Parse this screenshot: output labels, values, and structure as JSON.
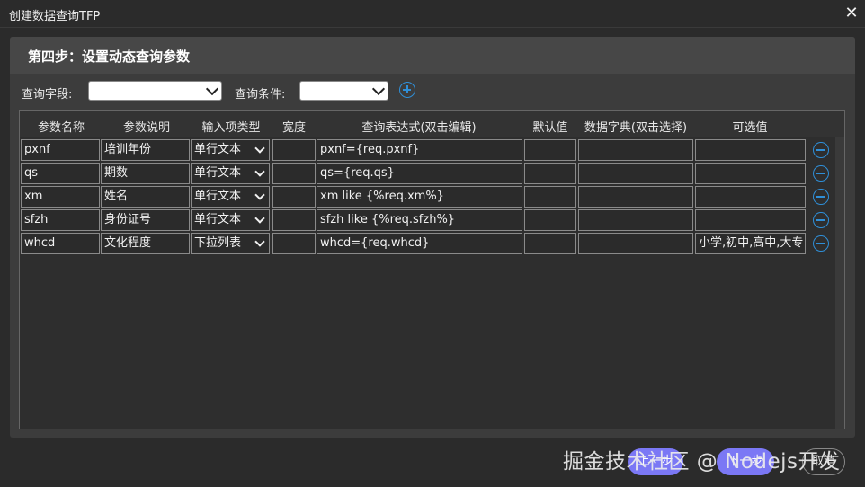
{
  "window": {
    "title": "创建数据查询TFP",
    "close_glyph": "✕"
  },
  "step_title": "第四步：设置动态查询参数",
  "filters": {
    "field_label": "查询字段:",
    "condition_label": "查询条件:"
  },
  "columns": [
    "参数名称",
    "参数说明",
    "输入项类型",
    "宽度",
    "查询表达式(双击编辑)",
    "默认值",
    "数据字典(双击选择)",
    "可选值"
  ],
  "rows": [
    {
      "name": "pxnf",
      "desc": "培训年份",
      "type": "单行文本",
      "width": "",
      "expr": "pxnf={req.pxnf}",
      "default": "",
      "dict": "",
      "options": ""
    },
    {
      "name": "qs",
      "desc": "期数",
      "type": "单行文本",
      "width": "",
      "expr": "qs={req.qs}",
      "default": "",
      "dict": "",
      "options": ""
    },
    {
      "name": "xm",
      "desc": "姓名",
      "type": "单行文本",
      "width": "",
      "expr": "xm like {%req.xm%}",
      "default": "",
      "dict": "",
      "options": ""
    },
    {
      "name": "sfzh",
      "desc": "身份证号",
      "type": "单行文本",
      "width": "",
      "expr": "sfzh like {%req.sfzh%}",
      "default": "",
      "dict": "",
      "options": ""
    },
    {
      "name": "whcd",
      "desc": "文化程度",
      "type": "下拉列表",
      "width": "",
      "expr": "whcd={req.whcd}",
      "default": "",
      "dict": "",
      "options": "小学,初中,高中,大专"
    }
  ],
  "footer": {
    "prev_label": "上一步",
    "next_label": "下一步",
    "cancel_label": "取消"
  },
  "watermark": "掘金技术社区 @ Nodejs开发",
  "colors": {
    "accent": "#2f8fd8",
    "button": "#7b78f5",
    "background": "#2b2b2b"
  }
}
